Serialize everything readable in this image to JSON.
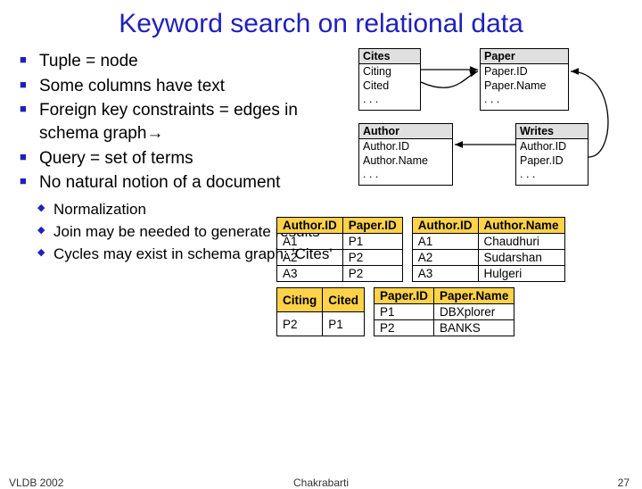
{
  "title": "Keyword search on relational data",
  "bullets": [
    "Tuple = node",
    "Some columns have text",
    "Foreign key constraints = edges in schema graph→",
    "Query = set of terms",
    "No natural notion of a document"
  ],
  "subbullets": [
    "Normalization",
    "Join may be needed to generate results",
    "Cycles may exist in schema graph: 'Cites'"
  ],
  "schema": {
    "cites": {
      "header": "Cites",
      "fields": [
        "Citing",
        "Cited",
        ". . ."
      ]
    },
    "paper": {
      "header": "Paper",
      "fields": [
        "Paper.ID",
        "Paper.Name",
        ". . ."
      ]
    },
    "author": {
      "header": "Author",
      "fields": [
        "Author.ID",
        "Author.Name",
        ". . ."
      ]
    },
    "writes": {
      "header": "Writes",
      "fields": [
        "Author.ID",
        "Paper.ID",
        ". . ."
      ]
    }
  },
  "tables": {
    "writes_data": {
      "headers": [
        "Author.ID",
        "Paper.ID"
      ],
      "rows": [
        [
          "A1",
          "P1"
        ],
        [
          "A2",
          "P2"
        ],
        [
          "A3",
          "P2"
        ]
      ]
    },
    "author_data": {
      "headers": [
        "Author.ID",
        "Author.Name"
      ],
      "rows": [
        [
          "A1",
          "Chaudhuri"
        ],
        [
          "A2",
          "Sudarshan"
        ],
        [
          "A3",
          "Hulgeri"
        ]
      ]
    },
    "cites_data": {
      "headers": [
        "Citing",
        "Cited"
      ],
      "rows": [
        [
          "P2",
          "P1"
        ]
      ]
    },
    "paper_data": {
      "headers": [
        "Paper.ID",
        "Paper.Name"
      ],
      "rows": [
        [
          "P1",
          "DBXplorer"
        ],
        [
          "P2",
          "BANKS"
        ]
      ]
    }
  },
  "footer": {
    "left": "VLDB 2002",
    "center": "Chakrabarti",
    "right": "27"
  }
}
